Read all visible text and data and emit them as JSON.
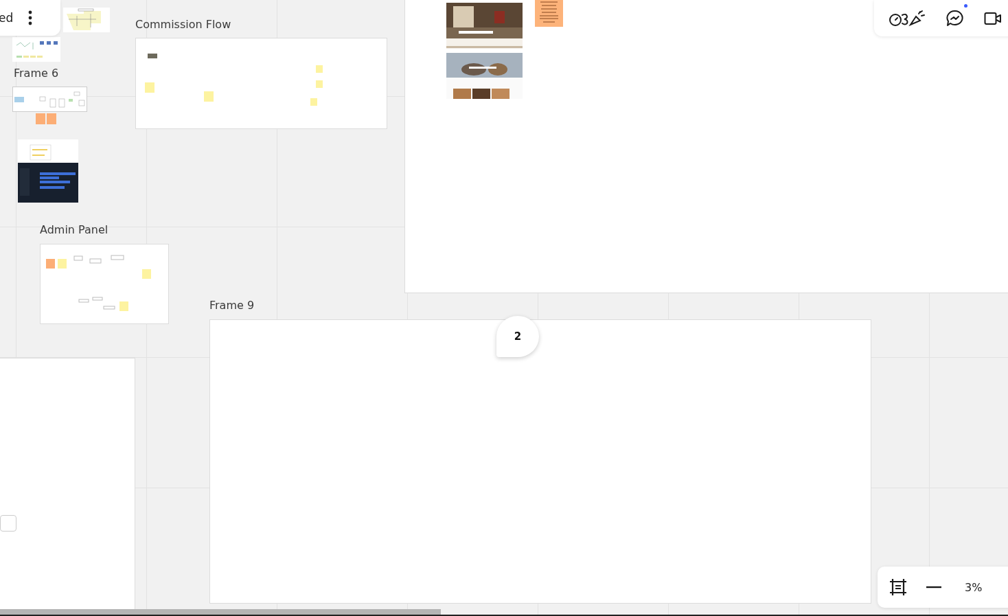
{
  "board": {
    "title": "ed"
  },
  "frames": [
    {
      "label": "Commission Flow"
    },
    {
      "label": "Frame 6"
    },
    {
      "label": "Admin Panel"
    },
    {
      "label": "Frame 9"
    }
  ],
  "comment": {
    "count": "2"
  },
  "toolbar": {
    "chat_unread": true
  },
  "zoom": {
    "reading": "3%"
  }
}
